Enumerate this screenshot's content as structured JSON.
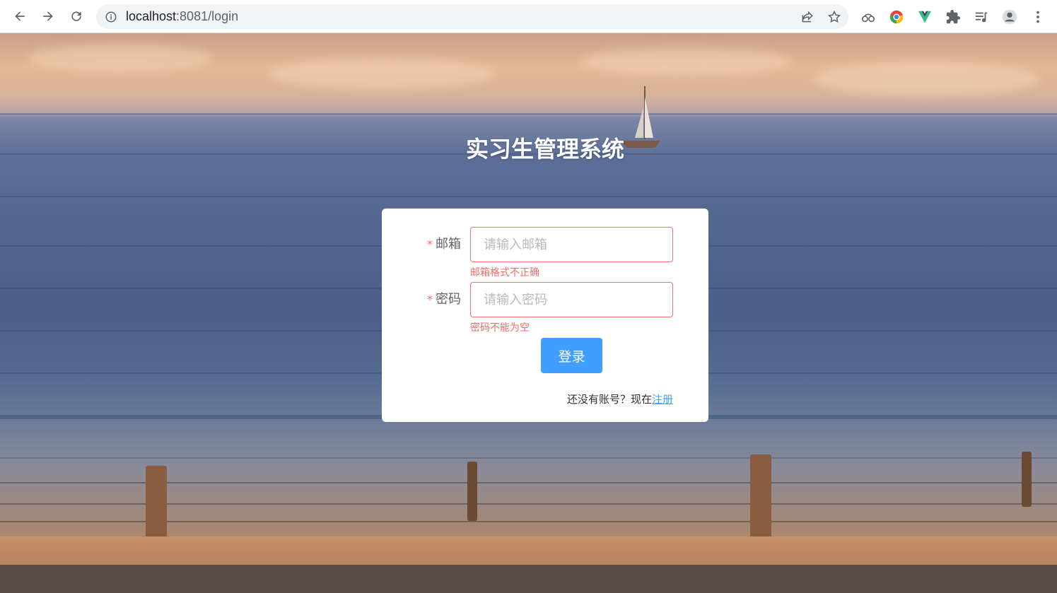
{
  "browser": {
    "url_host": "localhost",
    "url_rest": ":8081/login",
    "icons": [
      "back-icon",
      "forward-icon",
      "reload-icon",
      "info-icon",
      "share-icon",
      "bookmark-star-icon",
      "extension-cloud-icon",
      "chrome-color-icon",
      "vue-devtools-icon",
      "puzzle-icon",
      "media-queue-icon",
      "profile-icon",
      "menu-icon"
    ]
  },
  "login": {
    "title": "实习生管理系统",
    "email_label": "邮箱",
    "email_placeholder": "请输入邮箱",
    "email_error": "邮箱格式不正确",
    "password_label": "密码",
    "password_placeholder": "请输入密码",
    "password_error": "密码不能为空",
    "required_mark": "*",
    "submit_label": "登录",
    "register_prompt": "还没有账号？现在",
    "register_link": "注册"
  },
  "colors": {
    "accent": "#409eff",
    "error": "#f56c6c"
  }
}
